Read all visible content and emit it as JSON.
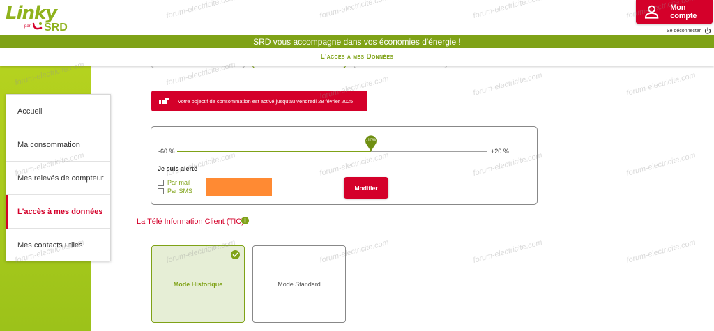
{
  "logo": {
    "brand": "Linky",
    "par": "par",
    "operator": "SRD"
  },
  "header": {
    "account_label": "Mon compte",
    "logout_label": "Se déconnecter"
  },
  "banner": {
    "text": "SRD vous accompagne dans vos économies d'énergie !"
  },
  "subnav": {
    "title": "L'accès à mes Données"
  },
  "sidebar": {
    "items": [
      {
        "label": "Accueil",
        "active": false
      },
      {
        "label": "Ma consommation",
        "active": false
      },
      {
        "label": "Mes relevés de compteur",
        "active": false
      },
      {
        "label": "L'accès à mes données",
        "active": true
      },
      {
        "label": "Mes contacts utiles",
        "active": false
      }
    ]
  },
  "alert": {
    "text": "Votre objectif de consommation est activé jusqu'au vendredi 28 février 2025"
  },
  "objective": {
    "min_label": "-60 %",
    "max_label": "+20 %",
    "min": -60,
    "max": 20,
    "value": -10,
    "value_label": "-10%",
    "alert_title": "Je suis alerté",
    "by_mail": "Par mail",
    "by_sms": "Par SMS",
    "modify_label": "Modifier"
  },
  "tic": {
    "title": "La Télé Information Client (TIC)",
    "modes": [
      {
        "label": "Mode Historique",
        "selected": true
      },
      {
        "label": "Mode Standard",
        "selected": false
      }
    ]
  },
  "watermark": "forum-electricite.com",
  "colors": {
    "brand_green": "#7fa217",
    "accent_red": "#d4002a",
    "redaction": "#ff8a33"
  }
}
